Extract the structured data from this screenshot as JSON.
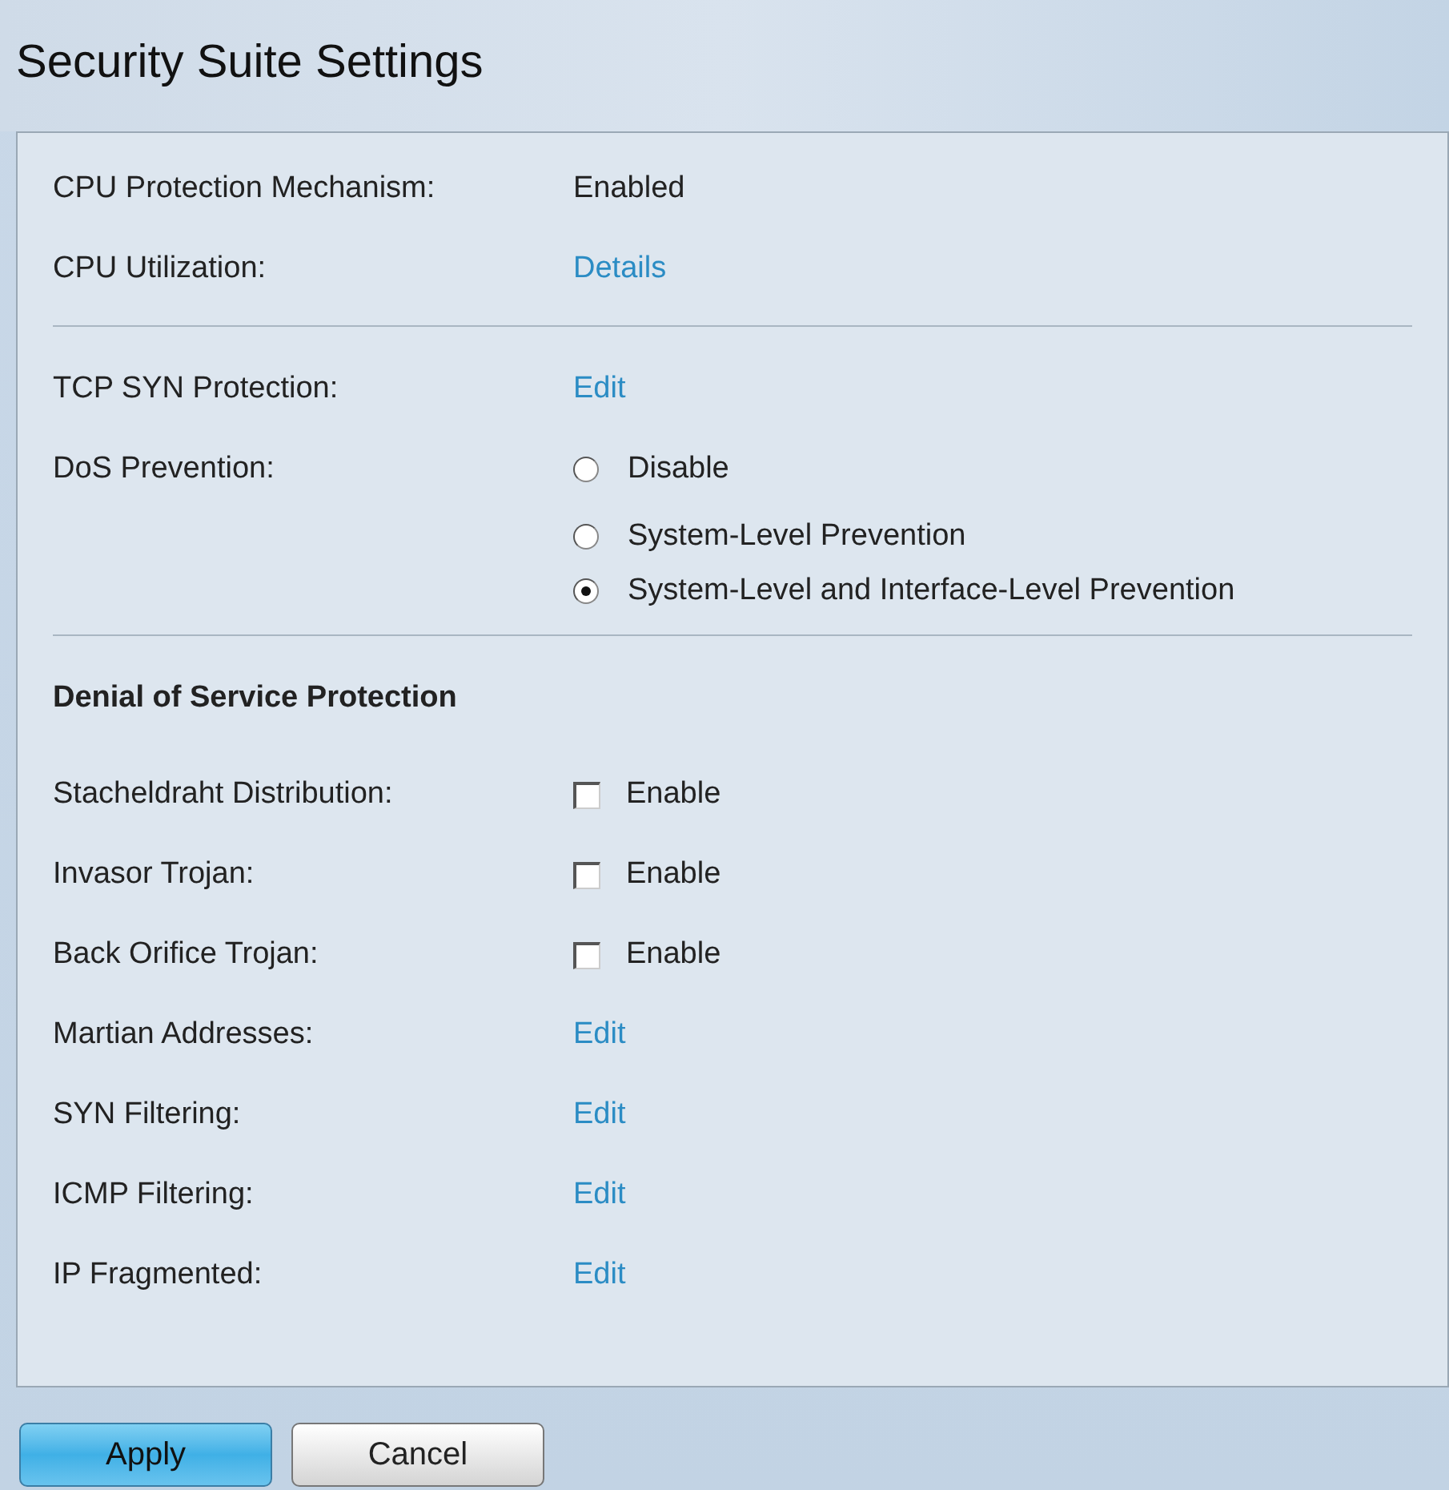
{
  "page": {
    "title": "Security Suite Settings"
  },
  "sections": [
    {
      "rows": [
        {
          "kind": "text",
          "label": "CPU Protection Mechanism:",
          "value": "Enabled"
        },
        {
          "kind": "link",
          "label": "CPU Utilization:",
          "value": "Details"
        }
      ]
    },
    {
      "rows": [
        {
          "kind": "link",
          "label": "TCP SYN Protection:",
          "value": "Edit"
        },
        {
          "kind": "radio",
          "label": "DoS Prevention:",
          "options": [
            {
              "label": "Disable",
              "selected": false
            },
            {
              "label": "System-Level Prevention",
              "selected": false
            },
            {
              "label": "System-Level and Interface-Level Prevention",
              "selected": true
            }
          ]
        }
      ]
    },
    {
      "heading": "Denial of Service Protection",
      "rows": [
        {
          "kind": "checkbox",
          "label": "Stacheldraht Distribution:",
          "value": "Enable",
          "checked": false
        },
        {
          "kind": "checkbox",
          "label": "Invasor Trojan:",
          "value": "Enable",
          "checked": false
        },
        {
          "kind": "checkbox",
          "label": "Back Orifice Trojan:",
          "value": "Enable",
          "checked": false
        },
        {
          "kind": "link",
          "label": "Martian Addresses:",
          "value": "Edit"
        },
        {
          "kind": "link",
          "label": "SYN Filtering:",
          "value": "Edit"
        },
        {
          "kind": "link",
          "label": "ICMP Filtering:",
          "value": "Edit"
        },
        {
          "kind": "link",
          "label": "IP Fragmented:",
          "value": "Edit"
        }
      ]
    }
  ],
  "buttons": [
    {
      "kind": "primary",
      "label": "Apply"
    },
    {
      "kind": "secondary",
      "label": "Cancel"
    }
  ]
}
